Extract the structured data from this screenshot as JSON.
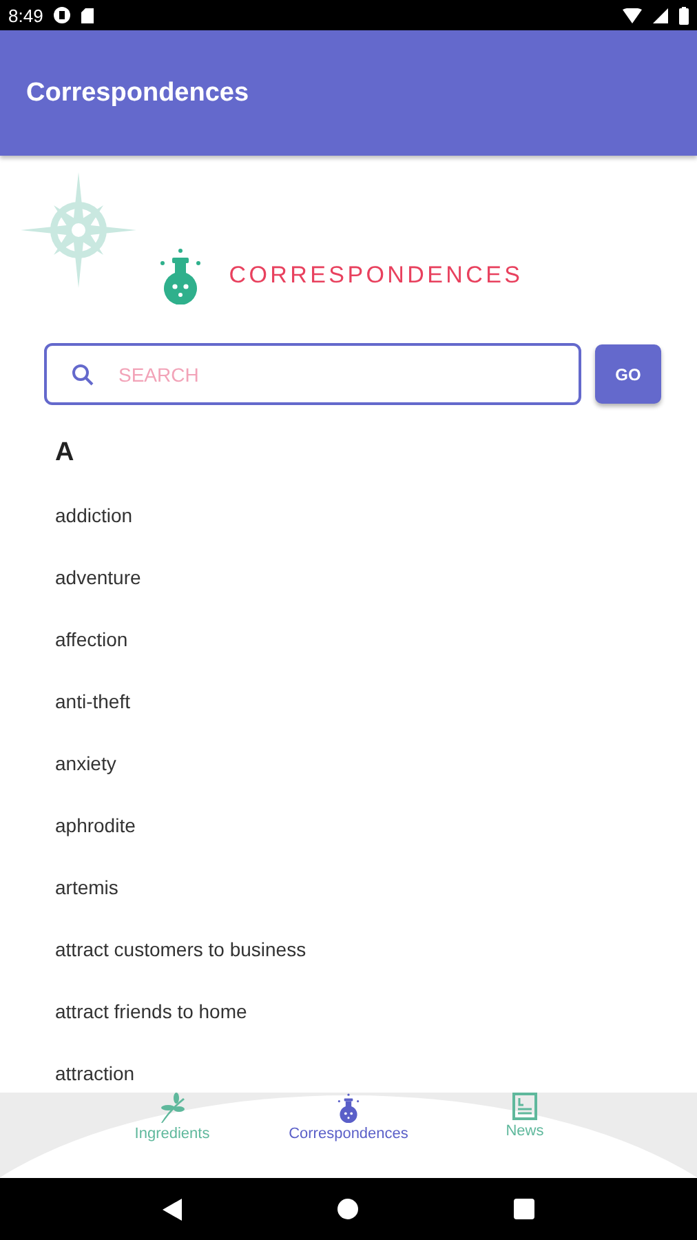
{
  "status_bar": {
    "time": "8:49"
  },
  "app_bar": {
    "title": "Correspondences"
  },
  "header": {
    "title": "CORRESPONDENCES"
  },
  "search": {
    "placeholder": "SEARCH",
    "button": "GO"
  },
  "section": {
    "letter": "A",
    "items": [
      "addiction",
      "adventure",
      "affection",
      "anti-theft",
      "anxiety",
      "aphrodite",
      "artemis",
      "attract customers to business",
      "attract friends to home",
      "attraction"
    ]
  },
  "bottom_nav": [
    {
      "kind": "leaf",
      "label": "Ingredients",
      "selected": false
    },
    {
      "kind": "flask",
      "label": "Correspondences",
      "selected": true
    },
    {
      "kind": "news",
      "label": "News",
      "selected": false
    }
  ]
}
